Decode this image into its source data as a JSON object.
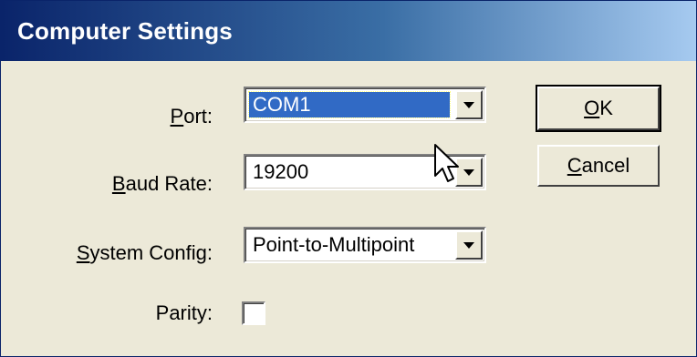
{
  "window": {
    "title": "Computer Settings"
  },
  "fields": {
    "port": {
      "label_mnemonic": "P",
      "label_rest": "ort:",
      "value": "COM1"
    },
    "baud_rate": {
      "label_mnemonic": "B",
      "label_rest": "aud Rate:",
      "value": "19200"
    },
    "system_config": {
      "label_mnemonic": "S",
      "label_rest": "ystem Config:",
      "value": "Point-to-Multipoint"
    },
    "parity": {
      "label": "Parity:",
      "checked": false
    }
  },
  "buttons": {
    "ok": {
      "mnemonic": "O",
      "rest": "K"
    },
    "cancel": {
      "mnemonic": "C",
      "rest": "ancel"
    }
  },
  "colors": {
    "title_bar_start": "#0A246A",
    "title_bar_end": "#A6CAF0",
    "selection": "#316AC5",
    "dialog_bg": "#ECE9D8"
  },
  "icons": [
    "dropdown-arrow-icon",
    "mouse-cursor-icon"
  ]
}
